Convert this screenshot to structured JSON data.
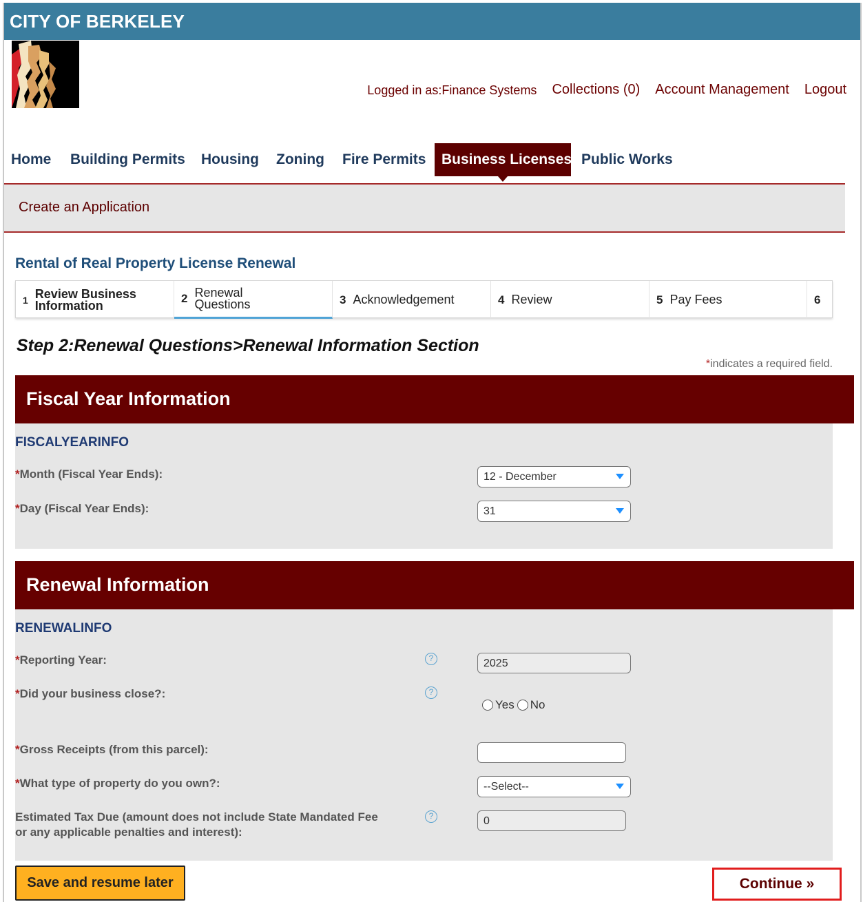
{
  "header": {
    "city_title": "CITY OF BERKELEY",
    "logged_in": "Logged in as:Finance Systems",
    "collections": "Collections (0)",
    "account_management": "Account Management",
    "logout": "Logout"
  },
  "nav": {
    "items": [
      "Home",
      "Building Permits",
      "Housing",
      "Zoning",
      "Fire Permits",
      "Business Licenses",
      "Public Works"
    ],
    "active": "Business Licenses"
  },
  "subbar": {
    "label": "Create an Application"
  },
  "application": {
    "title": "Rental of Real Property License Renewal"
  },
  "steps": [
    {
      "num": "1",
      "label": "Review Business Information"
    },
    {
      "num": "2",
      "label": "Renewal Questions",
      "active": true
    },
    {
      "num": "3",
      "label": "Acknowledgement"
    },
    {
      "num": "4",
      "label": "Review"
    },
    {
      "num": "5",
      "label": "Pay Fees"
    },
    {
      "num": "6",
      "label": ""
    }
  ],
  "step_heading": "Step 2:Renewal Questions>Renewal Information Section",
  "required_note": {
    "asterisk": "*",
    "text": "indicates a required field."
  },
  "fiscal": {
    "section_title": "Fiscal Year Information",
    "subhead": "FISCALYEARINFO",
    "month_label": "Month (Fiscal Year Ends):",
    "month_value": "12 - December",
    "day_label": "Day (Fiscal Year Ends):",
    "day_value": "31"
  },
  "renewal": {
    "section_title": "Renewal Information",
    "subhead": "RENEWALINFO",
    "reporting_year_label": "Reporting Year:",
    "reporting_year_value": "2025",
    "business_close_label": "Did your business close?:",
    "yes_label": "Yes",
    "no_label": "No",
    "gross_receipts_label": "Gross Receipts (from this parcel):",
    "gross_receipts_value": "",
    "property_type_label": "What type of property do you own?:",
    "property_type_value": "--Select--",
    "estimated_tax_label_line1": "Estimated Tax Due (amount does not include State Mandated Fee",
    "estimated_tax_label_line2": "or any applicable penalties and interest):",
    "estimated_tax_value": "0"
  },
  "buttons": {
    "save_later": "Save and resume later",
    "continue": "Continue »"
  },
  "colors": {
    "topbar": "#3a7d9e",
    "section_header": "#660000",
    "nav_active": "#5c0000",
    "save_button": "#ffb020",
    "continue_highlight": "#e11d1d"
  }
}
